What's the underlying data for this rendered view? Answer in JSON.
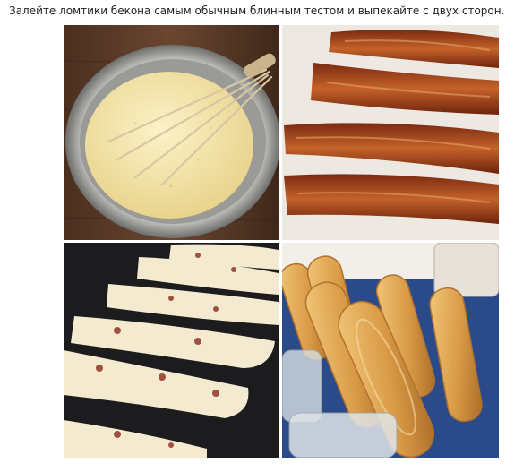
{
  "post": {
    "caption": "Залейте ломтики бекона самым обычным блинным тестом и выпекайте с двух сторон."
  },
  "photos": [
    {
      "name": "batter-bowl-photo"
    },
    {
      "name": "fried-bacon-photo"
    },
    {
      "name": "bacon-in-batter-photo"
    },
    {
      "name": "bacon-pancakes-photo"
    }
  ],
  "colors": {
    "wood": "#5a3a26",
    "batter": "#f3e6b0",
    "bacon": "#a8441e",
    "pan": "#1c1c1e",
    "pancake": "#d99a45"
  }
}
